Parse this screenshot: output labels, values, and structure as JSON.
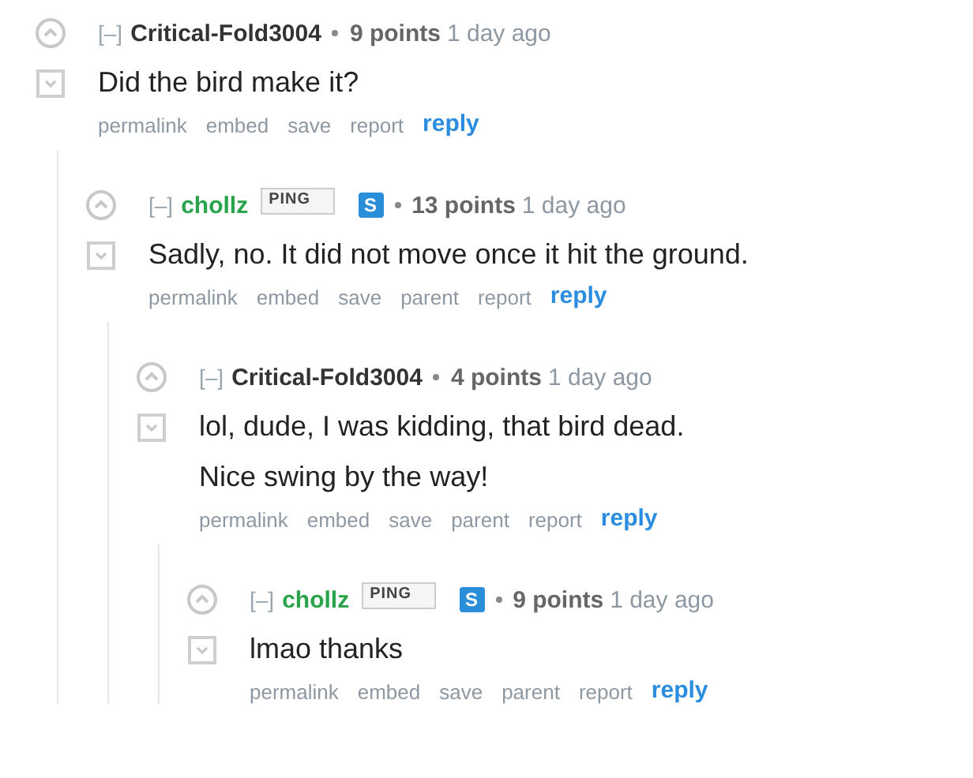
{
  "comments": [
    {
      "collapse": "[–]",
      "author": "Critical-Fold3004",
      "submitter": false,
      "points": "9 points",
      "time": "1 day ago",
      "body": [
        "Did the bird make it?"
      ],
      "links": [
        "permalink",
        "embed",
        "save",
        "report"
      ],
      "reply": "reply",
      "children": [
        {
          "collapse": "[–]",
          "author": "chollz",
          "submitter": true,
          "flair": "PING",
          "badge": "S",
          "points": "13 points",
          "time": "1 day ago",
          "body": [
            "Sadly, no. It did not move once it hit the ground."
          ],
          "links": [
            "permalink",
            "embed",
            "save",
            "parent",
            "report"
          ],
          "reply": "reply",
          "children": [
            {
              "collapse": "[–]",
              "author": "Critical-Fold3004",
              "submitter": false,
              "points": "4 points",
              "time": "1 day ago",
              "body": [
                "lol, dude, I was kidding, that bird dead.",
                "Nice swing by the way!"
              ],
              "links": [
                "permalink",
                "embed",
                "save",
                "parent",
                "report"
              ],
              "reply": "reply",
              "children": [
                {
                  "collapse": "[–]",
                  "author": "chollz",
                  "submitter": true,
                  "flair": "PING",
                  "badge": "S",
                  "points": "9 points",
                  "time": "1 day ago",
                  "body": [
                    "lmao thanks"
                  ],
                  "links": [
                    "permalink",
                    "embed",
                    "save",
                    "parent",
                    "report"
                  ],
                  "reply": "reply"
                }
              ]
            }
          ]
        }
      ]
    }
  ]
}
